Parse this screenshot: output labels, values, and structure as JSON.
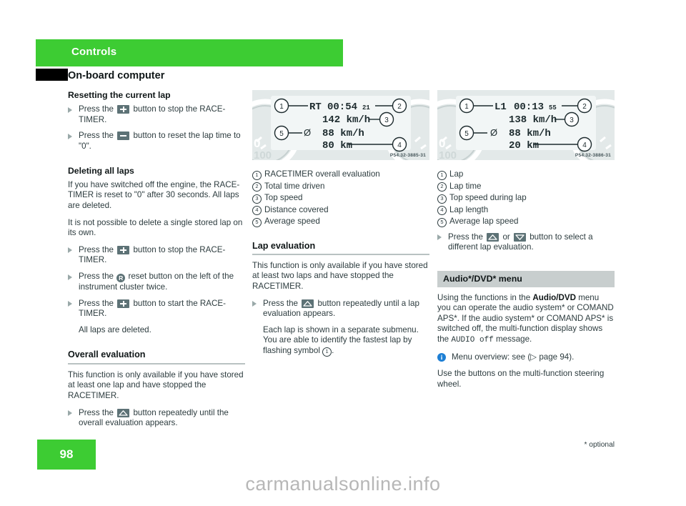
{
  "header": {
    "chapter": "Controls",
    "section": "On-board computer",
    "chapter_color": "#3dcc33",
    "tab_color": "#000000"
  },
  "col1": {
    "h_reset": "Resetting the current lap",
    "step_plus_stop_a": "Press the",
    "step_plus_stop_b": "button to stop the RACE-TIMER.",
    "step_minus_a": "Press the",
    "step_minus_b": "button to reset the lap time to \"0\".",
    "h_delete": "Deleting all laps",
    "p_delete_1": "If you have switched off the engine, the RACE-TIMER is reset to \"0\" after 30 seconds. All laps are deleted.",
    "p_delete_2": "It is not possible to delete a single stored lap on its own.",
    "step_plus_stop2_a": "Press the",
    "step_plus_stop2_b": "button to stop the RACE-TIMER.",
    "step_reset_a": "Press the",
    "step_reset_b": "reset button on the left of the instrument cluster twice.",
    "step_plus_start_a": "Press the",
    "step_plus_start_b": "button to start the RACE-TIMER.",
    "p_all_deleted": "All laps are deleted.",
    "h_overall": "Overall evaluation",
    "p_overall": "This function is only available if you have stored at least one lap and have stopped the RACETIMER.",
    "step_up_a": "Press the",
    "step_up_b": "button repeatedly until the overall evaluation appears."
  },
  "col2": {
    "image_code": "P54.32-3885-31",
    "display": {
      "line1_label": "RT",
      "line1_time": "00:54",
      "line1_small": "21",
      "line2": "142 km/h",
      "line3_symbol": "Ø",
      "line3": "88 km/h",
      "line4": "80 km"
    },
    "legend": [
      {
        "n": "1",
        "text": "RACETIMER overall evaluation"
      },
      {
        "n": "2",
        "text": "Total time driven"
      },
      {
        "n": "3",
        "text": "Top speed"
      },
      {
        "n": "4",
        "text": "Distance covered"
      },
      {
        "n": "5",
        "text": "Average speed"
      }
    ],
    "h_lap": "Lap evaluation",
    "p_lap": "This function is only available if you have stored at least two laps and have stopped the RACETIMER.",
    "step_up_a": "Press the",
    "step_up_b": "button repeatedly until a lap evaluation appears.",
    "p_submenu_a": "Each lap is shown in a separate submenu. You are able to identify the fastest lap by flashing symbol",
    "p_submenu_b": "."
  },
  "col3": {
    "image_code": "P54.32-3886-31",
    "display": {
      "line1_label": "L1",
      "line1_time": "00:13",
      "line1_small": "55",
      "line2": "138 km/h",
      "line3_symbol": "Ø",
      "line3": "88 km/h",
      "line4": "20 km"
    },
    "legend": [
      {
        "n": "1",
        "text": "Lap"
      },
      {
        "n": "2",
        "text": "Lap time"
      },
      {
        "n": "3",
        "text": "Top speed during lap"
      },
      {
        "n": "4",
        "text": "Lap length"
      },
      {
        "n": "5",
        "text": "Average lap speed"
      }
    ],
    "step_select_a": "Press the",
    "step_select_or": "or",
    "step_select_b": "button to select a different lap evaluation.",
    "h_audio": "Audio*/DVD* menu",
    "p_audio_1a": "Using the functions in the",
    "p_audio_1b": "Audio/DVD",
    "p_audio_1c": "menu you can operate the audio system* or COMAND APS*. If the audio system* or COMAND APS* is switched off, the multi-function display shows the",
    "p_audio_mono": "AUDIO off",
    "p_audio_1d": "message.",
    "note_text": "Menu overview: see (▷ page 94).",
    "p_audio_2": "Use the buttons on the multi-function steering wheel."
  },
  "footer": {
    "page_number": "98",
    "optional_note": "* optional",
    "watermark": "carmanualsonline.info"
  }
}
